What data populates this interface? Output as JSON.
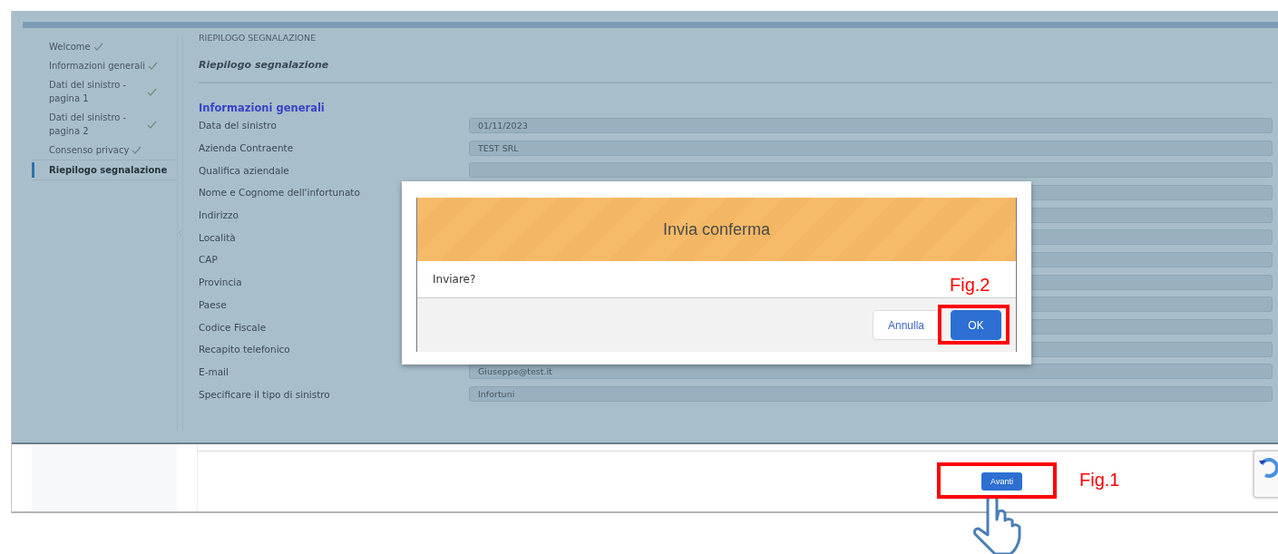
{
  "sidebar": {
    "items": [
      {
        "label": "Welcome",
        "completed": true,
        "selected": false
      },
      {
        "label": "Informazioni generali",
        "completed": true,
        "selected": false
      },
      {
        "label": "Dati del sinistro - pagina 1",
        "completed": true,
        "selected": false
      },
      {
        "label": "Dati del sinistro - pagina 2",
        "completed": true,
        "selected": false
      },
      {
        "label": "Consenso privacy",
        "completed": true,
        "selected": false
      },
      {
        "label": "Riepilogo segnalazione",
        "completed": false,
        "selected": true
      }
    ]
  },
  "section_header": "RIEPILOGO SEGNALAZIONE",
  "page_title": "Riepilogo segnalazione",
  "group_title": "Informazioni generali",
  "fields": [
    {
      "label": "Data del sinistro",
      "value": "01/11/2023"
    },
    {
      "label": "Azienda Contraente",
      "value": "TEST SRL"
    },
    {
      "label": "Qualifica aziendale"
    },
    {
      "label": "Nome e Cognome dell'infortunato"
    },
    {
      "label": "Indirizzo"
    },
    {
      "label": "Località"
    },
    {
      "label": "CAP"
    },
    {
      "label": "Provincia"
    },
    {
      "label": "Paese"
    },
    {
      "label": "Codice Fiscale"
    },
    {
      "label": "Recapito telefonico"
    },
    {
      "label": "E-mail",
      "value": "Giuseppe@test.it"
    },
    {
      "label": "Specificare il tipo di sinistro",
      "value": "Infortuni"
    }
  ],
  "dialog": {
    "title": "Invia conferma",
    "message": "Inviare?",
    "buttons": [
      {
        "label": "Annulla",
        "kind": "neutral"
      },
      {
        "label": "OK",
        "kind": "brand"
      }
    ]
  },
  "footer": {
    "button": "Avanti"
  },
  "annotations": [
    {
      "label": "Fig.2"
    },
    {
      "label": "Fig.1"
    }
  ]
}
